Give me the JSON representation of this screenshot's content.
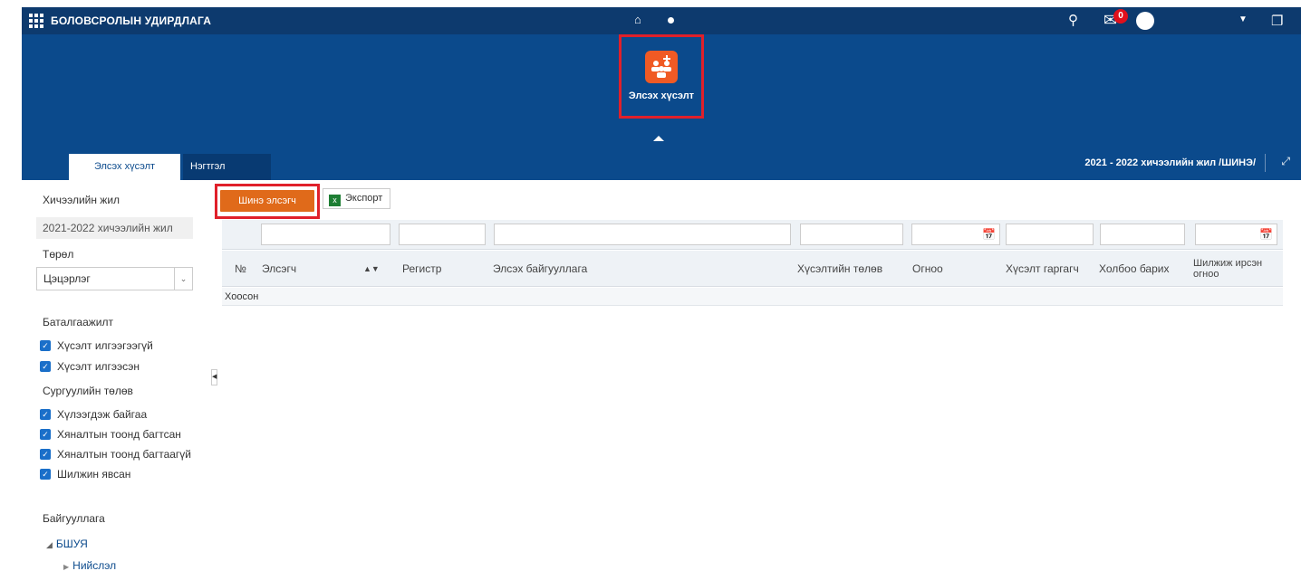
{
  "topbar": {
    "app_title": "БОЛОВСРОЛЫН УДИРДЛАГА",
    "notification_count": "0"
  },
  "launch_tile": {
    "label": "Элсэх хүсэлт",
    "icon": "users-add-icon",
    "color": "#f05a24"
  },
  "tabs": [
    {
      "label": "Элсэх хүсэлт",
      "active": true
    },
    {
      "label": "Нэгтгэл",
      "active": false
    }
  ],
  "school_year_label": "2021 - 2022 хичээлийн жил /ШИНЭ/",
  "filters": {
    "year_label": "Хичээлийн жил",
    "year_value": "2021-2022 хичээлийн жил",
    "type_label": "Төрөл",
    "type_value": "Цэцэрлэг",
    "confirmation_label": "Баталгаажилт",
    "confirmation_options": [
      {
        "label": "Хүсэлт илгээгээгүй",
        "checked": true
      },
      {
        "label": "Хүсэлт илгээсэн",
        "checked": true
      }
    ],
    "school_status_label": "Сургуулийн төлөв",
    "school_status_options": [
      {
        "label": "Хүлээгдэж байгаа",
        "checked": true
      },
      {
        "label": "Хяналтын тоонд багтсан",
        "checked": true
      },
      {
        "label": "Хяналтын тоонд багтаагүй",
        "checked": true
      },
      {
        "label": "Шилжин явсан",
        "checked": true
      }
    ],
    "org_label": "Байгууллага",
    "org_tree": {
      "root": "БШУЯ",
      "child": "Нийслэл"
    }
  },
  "toolbar": {
    "new_button": "Шинэ элсэгч",
    "export_button": "Экспорт"
  },
  "table": {
    "columns": [
      "№",
      "Элсэгч",
      "Регистр",
      "Элсэх байгууллага",
      "Хүсэлтийн төлөв",
      "Огноо",
      "Хүсэлт гаргагч",
      "Холбоо барих",
      "Шилжиж ирсэн огноо"
    ],
    "empty_text": "Хоосон"
  },
  "colors": {
    "topbar": "#0d3a6e",
    "banner": "#0b4a8c",
    "accent_button": "#e06a1a",
    "highlight_border": "#e0202a",
    "checkbox": "#1a6fc9"
  }
}
